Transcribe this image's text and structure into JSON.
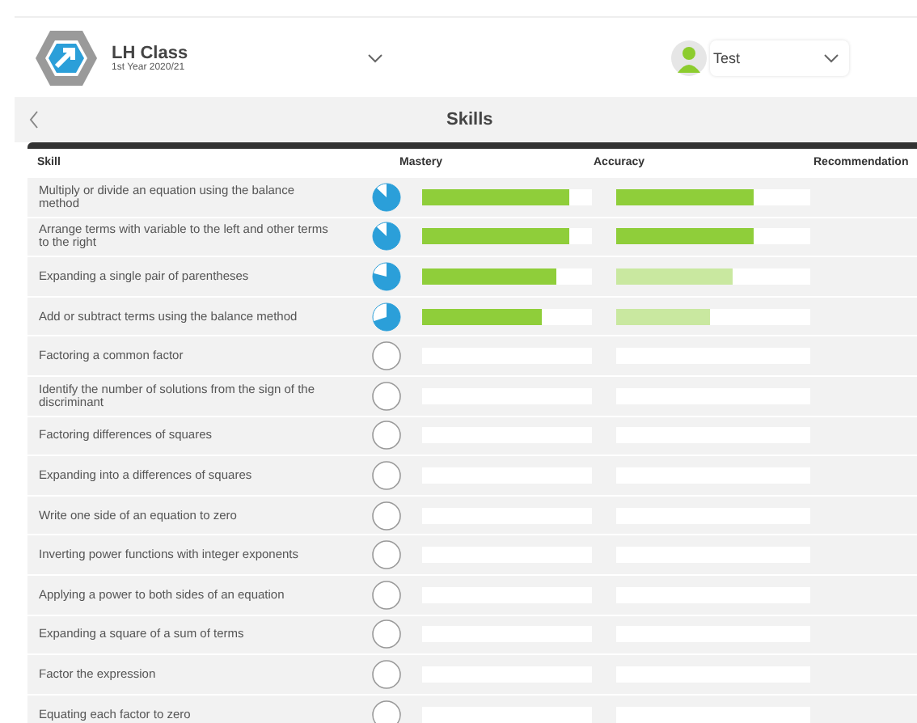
{
  "header": {
    "class_name": "LH Class",
    "class_year": "1st Year 2020/21",
    "user": "Test"
  },
  "title": "Skills",
  "columns": [
    "Skill",
    "Mastery",
    "Accuracy",
    "Recommendation"
  ],
  "skills": [
    {
      "name": "Multiply or divide an equation using the balance method",
      "mastery": {
        "level": 0.87
      },
      "accuracy": {
        "level": 0.71,
        "color": "#8fce3a"
      }
    },
    {
      "name": "Arrange terms with variable to the left and other terms to the right",
      "mastery": {
        "level": 0.87
      },
      "accuracy": {
        "level": 0.71,
        "color": "#8fce3a"
      }
    },
    {
      "name": "Expanding a single pair of parentheses",
      "mastery": {
        "level": 0.79
      },
      "accuracy": {
        "level": 0.6,
        "color": "#c9e8a0"
      }
    },
    {
      "name": "Add or subtract terms using the balance method",
      "mastery": {
        "level": 0.7
      },
      "accuracy": {
        "level": 0.48,
        "color": "#c9e8a0"
      }
    },
    {
      "name": "Factoring a common factor"
    },
    {
      "name": "Identify the number of solutions from the sign of the discriminant"
    },
    {
      "name": "Factoring differences of squares"
    },
    {
      "name": "Expanding into a differences of squares"
    },
    {
      "name": "Write one side of an equation to zero"
    },
    {
      "name": "Inverting power functions with integer exponents"
    },
    {
      "name": "Applying a power to both sides of an equation"
    },
    {
      "name": "Expanding a square of a sum of terms"
    },
    {
      "name": "Factor the expression"
    },
    {
      "name": "Equating each factor to zero"
    }
  ]
}
